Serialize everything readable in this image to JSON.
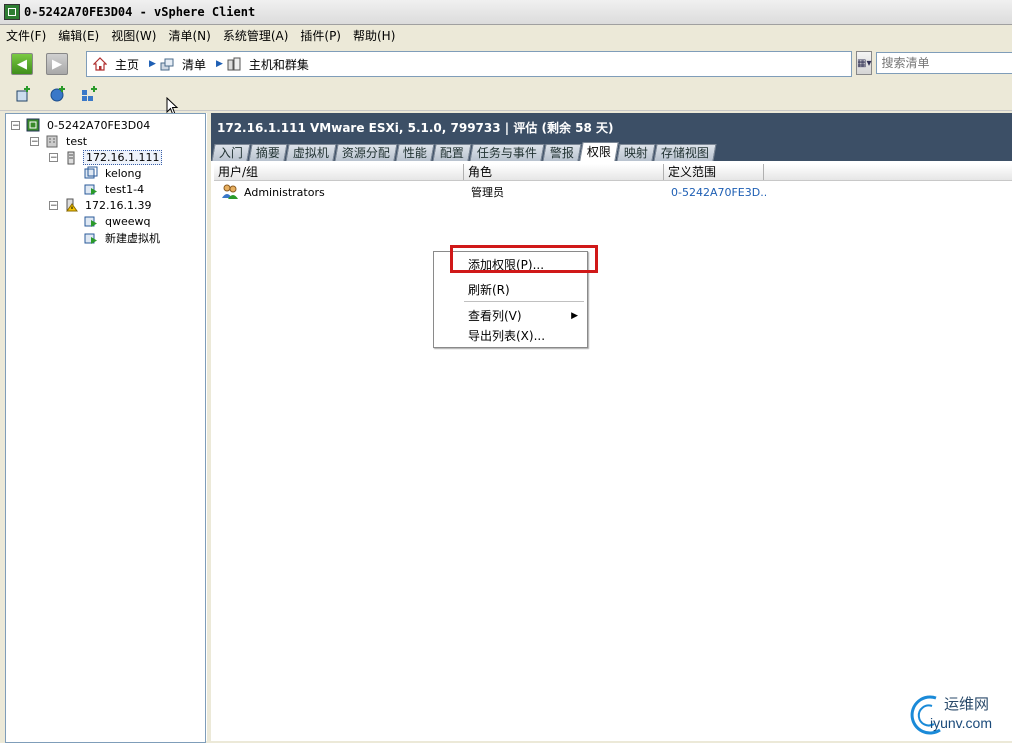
{
  "window": {
    "title": "0-5242A70FE3D04 - vSphere Client"
  },
  "menu": [
    {
      "label": "文件(F)"
    },
    {
      "label": "编辑(E)"
    },
    {
      "label": "视图(W)"
    },
    {
      "label": "清单(N)"
    },
    {
      "label": "系统管理(A)"
    },
    {
      "label": "插件(P)"
    },
    {
      "label": "帮助(H)"
    }
  ],
  "breadcrumb": [
    {
      "label": "主页",
      "icon": "home-icon"
    },
    {
      "label": "清单",
      "icon": "inventory-icon"
    },
    {
      "label": "主机和群集",
      "icon": "hosts-clusters-icon"
    }
  ],
  "search": {
    "placeholder": "搜索清单"
  },
  "tree": {
    "root": "0-5242A70FE3D04",
    "datacenter": "test",
    "host1": "172.16.1.111",
    "vm1": "kelong",
    "vm2": "test1-4",
    "host2": "172.16.1.39",
    "vm3": "qweewq",
    "vm4": "新建虚拟机"
  },
  "header": {
    "title": "172.16.1.111 VMware ESXi, 5.1.0, 799733 | 评估 (剩余 58 天)"
  },
  "tabs": [
    {
      "label": "入门"
    },
    {
      "label": "摘要"
    },
    {
      "label": "虚拟机"
    },
    {
      "label": "资源分配"
    },
    {
      "label": "性能"
    },
    {
      "label": "配置"
    },
    {
      "label": "任务与事件"
    },
    {
      "label": "警报"
    },
    {
      "label": "权限"
    },
    {
      "label": "映射"
    },
    {
      "label": "存储视图"
    }
  ],
  "permissions_table": {
    "columns": [
      "用户/组",
      "角色",
      "定义范围"
    ],
    "rows": [
      {
        "user": "Administrators",
        "role": "管理员",
        "scope": "0-5242A70FE3D..."
      }
    ]
  },
  "context_menu": {
    "add_permission": "添加权限(P)...",
    "refresh": "刷新(R)",
    "view_columns": "查看列(V)",
    "export_list": "导出列表(X)..."
  },
  "watermark": {
    "cn": "运维网",
    "en": "iyunv.com"
  }
}
